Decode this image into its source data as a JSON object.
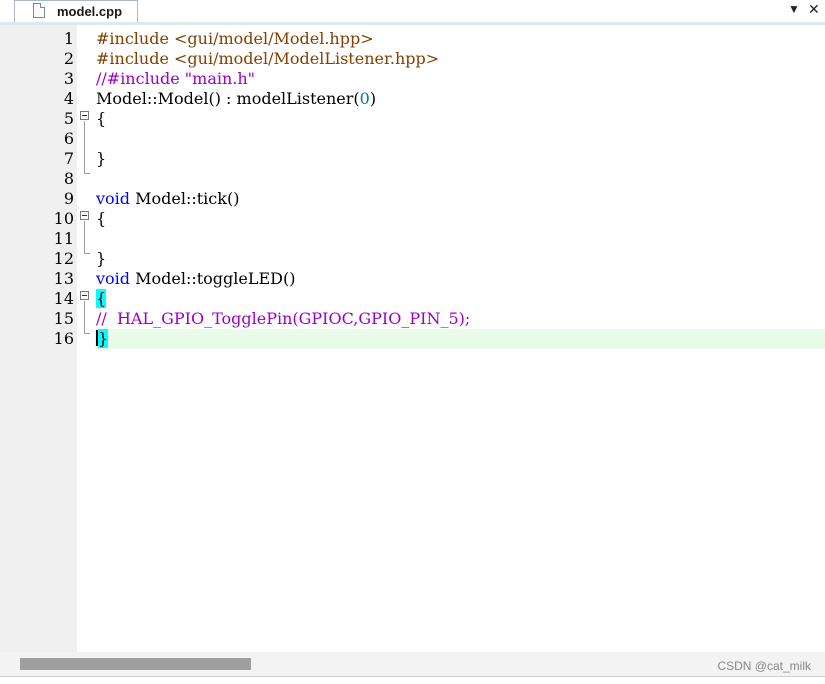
{
  "tab": {
    "filename": "model.cpp",
    "dropdown_icon": "▼",
    "close_icon": "✕"
  },
  "lines": [
    {
      "num": "1",
      "spans": [
        {
          "t": "#include <gui/model/Model.hpp>",
          "c": "pp"
        }
      ]
    },
    {
      "num": "2",
      "spans": [
        {
          "t": "#include <gui/model/ModelListener.hpp>",
          "c": "pp"
        }
      ]
    },
    {
      "num": "3",
      "spans": [
        {
          "t": "//#include \"main.h\"",
          "c": "cm"
        }
      ]
    },
    {
      "num": "4",
      "spans": [
        {
          "t": "Model::Model() : modelListener(",
          "c": ""
        },
        {
          "t": "0",
          "c": "num"
        },
        {
          "t": ")",
          "c": ""
        }
      ]
    },
    {
      "num": "5",
      "spans": [
        {
          "t": "{",
          "c": ""
        }
      ]
    },
    {
      "num": "6",
      "spans": []
    },
    {
      "num": "7",
      "spans": [
        {
          "t": "}",
          "c": ""
        }
      ]
    },
    {
      "num": "8",
      "spans": []
    },
    {
      "num": "9",
      "spans": [
        {
          "t": "void",
          "c": "kw"
        },
        {
          "t": " Model::tick()",
          "c": ""
        }
      ]
    },
    {
      "num": "10",
      "spans": [
        {
          "t": "{",
          "c": ""
        }
      ]
    },
    {
      "num": "11",
      "spans": []
    },
    {
      "num": "12",
      "spans": [
        {
          "t": "}",
          "c": ""
        }
      ]
    },
    {
      "num": "13",
      "spans": [
        {
          "t": "void",
          "c": "kw"
        },
        {
          "t": " Model::toggleLED()",
          "c": ""
        }
      ]
    },
    {
      "num": "14",
      "spans": [
        {
          "t": "{",
          "c": "brace-hl"
        }
      ]
    },
    {
      "num": "15",
      "spans": [
        {
          "t": "//  HAL_GPIO_TogglePin(GPIOC,GPIO_PIN_5);",
          "c": "cm"
        }
      ]
    },
    {
      "num": "16",
      "spans": [
        {
          "t": "|",
          "c": "caret"
        },
        {
          "t": "}",
          "c": "brace-hl"
        }
      ]
    }
  ],
  "watermark": "CSDN @cat_milk",
  "colors": {
    "preprocessor": "#804000",
    "comment": "#9900cc",
    "keyword": "#0000ff",
    "number": "#008080",
    "brace_match": "#00ffff",
    "current_line": "#e8fbe8"
  }
}
